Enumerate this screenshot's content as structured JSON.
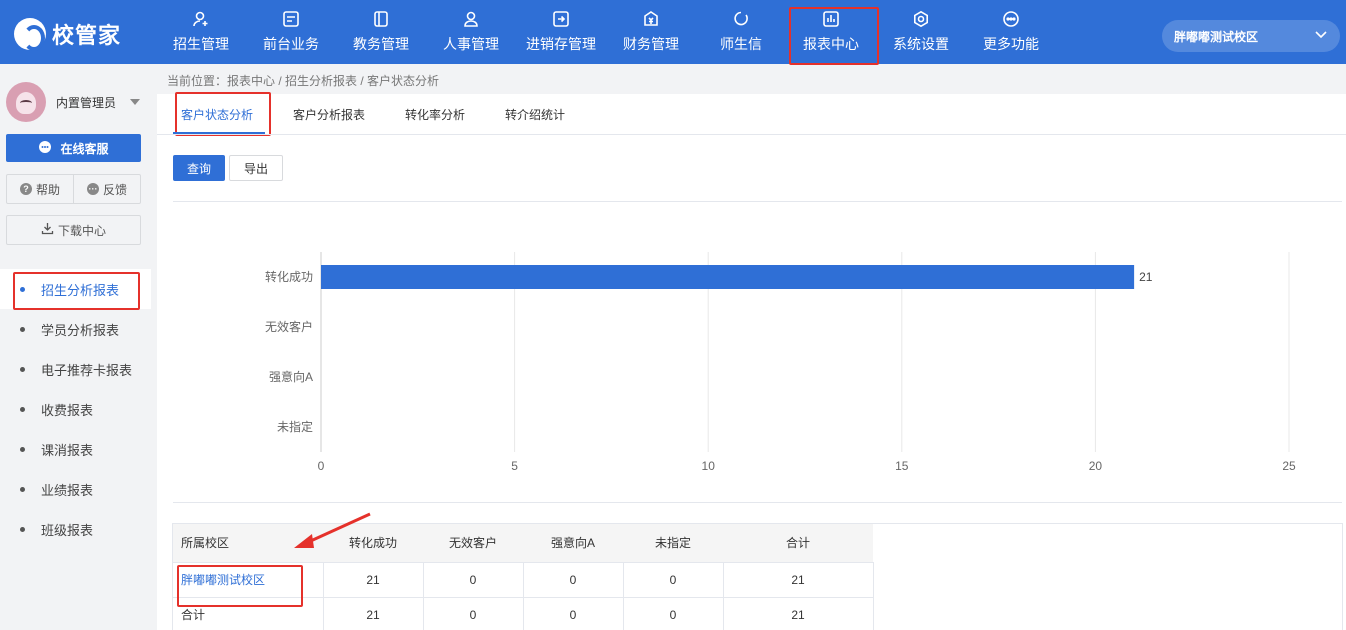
{
  "app": {
    "logo_text": "校管家"
  },
  "nav": [
    {
      "label": "招生管理",
      "icon": "user-add-icon"
    },
    {
      "label": "前台业务",
      "icon": "monitor-icon"
    },
    {
      "label": "教务管理",
      "icon": "book-icon"
    },
    {
      "label": "人事管理",
      "icon": "person-icon"
    },
    {
      "label": "进销存管理",
      "icon": "inventory-icon"
    },
    {
      "label": "财务管理",
      "icon": "finance-icon"
    },
    {
      "label": "师生信",
      "icon": "message-icon"
    },
    {
      "label": "报表中心",
      "icon": "report-icon",
      "active": true
    },
    {
      "label": "系统设置",
      "icon": "settings-icon"
    },
    {
      "label": "更多功能",
      "icon": "more-icon"
    }
  ],
  "campus": {
    "selected": "胖嘟嘟测试校区"
  },
  "sidebar": {
    "user_name": "内置管理员",
    "service_label": "在线客服",
    "help_label": "帮助",
    "feedback_label": "反馈",
    "download_label": "下载中心",
    "items": [
      {
        "label": "招生分析报表",
        "active": true
      },
      {
        "label": "学员分析报表"
      },
      {
        "label": "电子推荐卡报表"
      },
      {
        "label": "收费报表"
      },
      {
        "label": "课消报表"
      },
      {
        "label": "业绩报表"
      },
      {
        "label": "班级报表"
      }
    ]
  },
  "breadcrumb": "当前位置：报表中心 / 招生分析报表 / 客户状态分析",
  "tabs": [
    {
      "label": "客户状态分析",
      "active": true
    },
    {
      "label": "客户分析报表"
    },
    {
      "label": "转化率分析"
    },
    {
      "label": "转介绍统计"
    }
  ],
  "actions": {
    "query_label": "查询",
    "export_label": "导出"
  },
  "chart_data": {
    "type": "bar",
    "orientation": "horizontal",
    "categories": [
      "转化成功",
      "无效客户",
      "强意向A",
      "未指定"
    ],
    "values": [
      21,
      0,
      0,
      0
    ],
    "data_labels": [
      "21",
      "",
      "",
      ""
    ],
    "xlim": [
      0,
      25
    ],
    "xticks": [
      0,
      5,
      10,
      15,
      20,
      25
    ],
    "grid": "vertical",
    "color": "#2f6fd6"
  },
  "table": {
    "headers": [
      "所属校区",
      "转化成功",
      "无效客户",
      "强意向A",
      "未指定",
      "合计"
    ],
    "rows": [
      [
        "胖嘟嘟测试校区",
        "21",
        "0",
        "0",
        "0",
        "21"
      ],
      [
        "合计",
        "21",
        "0",
        "0",
        "0",
        "21"
      ]
    ]
  },
  "colors": {
    "brand": "#2f6fd6",
    "highlight": "#e5312b"
  }
}
